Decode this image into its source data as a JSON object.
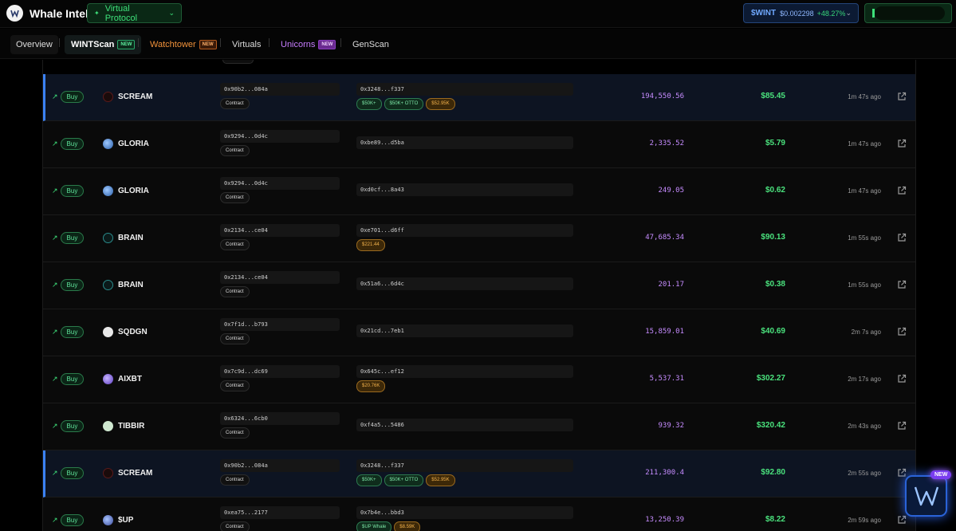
{
  "header": {
    "app_title": "Whale Intel",
    "protocol_selector": "Virtual Protocol",
    "token": {
      "symbol": "$WINT",
      "price": "$0.002298",
      "change": "+48.27%"
    }
  },
  "nav": {
    "tabs": [
      {
        "label": "Overview"
      },
      {
        "label": "WINTScan",
        "badge": "NEW"
      },
      {
        "label": "Watchtower",
        "badge": "NEW"
      },
      {
        "label": "Virtuals"
      },
      {
        "label": "Unicorns",
        "badge": "NEW"
      },
      {
        "label": "GenScan"
      }
    ]
  },
  "table": {
    "rows": [
      {
        "direction": "Buy",
        "token": "SCREAM",
        "token_address": "0x90b2...084a",
        "contract_label": "Contract",
        "tx": "0x3248...f337",
        "tags": [
          "$50K+",
          "$50K+ OTTO",
          "$52.95K"
        ],
        "amount": "194,550.56",
        "usd": "$85.45",
        "time": "1m 47s ago",
        "highlighted": true
      },
      {
        "direction": "Buy",
        "token": "GLORIA",
        "token_address": "0x9294...0d4c",
        "contract_label": "Contract",
        "tx": "0xbe89...d5ba",
        "tags": [],
        "amount": "2,335.52",
        "usd": "$5.79",
        "time": "1m 47s ago",
        "highlighted": false
      },
      {
        "direction": "Buy",
        "token": "GLORIA",
        "token_address": "0x9294...0d4c",
        "contract_label": "Contract",
        "tx": "0xd0cf...8a43",
        "tags": [],
        "amount": "249.05",
        "usd": "$0.62",
        "time": "1m 47s ago",
        "highlighted": false
      },
      {
        "direction": "Buy",
        "token": "BRAIN",
        "token_address": "0x2134...ce04",
        "contract_label": "Contract",
        "tx": "0xe701...d6ff",
        "tags": [
          "$221.44"
        ],
        "amount": "47,685.34",
        "usd": "$90.13",
        "time": "1m 55s ago",
        "highlighted": false
      },
      {
        "direction": "Buy",
        "token": "BRAIN",
        "token_address": "0x2134...ce04",
        "contract_label": "Contract",
        "tx": "0x51a6...6d4c",
        "tags": [],
        "amount": "201.17",
        "usd": "$0.38",
        "time": "1m 55s ago",
        "highlighted": false
      },
      {
        "direction": "Buy",
        "token": "SQDGN",
        "token_address": "0x7f1d...b793",
        "contract_label": "Contract",
        "tx": "0x21cd...7eb1",
        "tags": [],
        "amount": "15,859.01",
        "usd": "$40.69",
        "time": "2m 7s ago",
        "highlighted": false
      },
      {
        "direction": "Buy",
        "token": "AIXBT",
        "token_address": "0x7c9d...dc69",
        "contract_label": "Contract",
        "tx": "0x645c...ef12",
        "tags": [
          "$20.76K"
        ],
        "amount": "5,537.31",
        "usd": "$302.27",
        "time": "2m 17s ago",
        "highlighted": false
      },
      {
        "direction": "Buy",
        "token": "TIBBIR",
        "token_address": "0x6324...6cb0",
        "contract_label": "Contract",
        "tx": "0xf4a5...5486",
        "tags": [],
        "amount": "939.32",
        "usd": "$320.42",
        "time": "2m 43s ago",
        "highlighted": false
      },
      {
        "direction": "Buy",
        "token": "SCREAM",
        "token_address": "0x90b2...084a",
        "contract_label": "Contract",
        "tx": "0x3248...f337",
        "tags": [
          "$50K+",
          "$50K+ OTTO",
          "$52.95K"
        ],
        "amount": "211,300.4",
        "usd": "$92.80",
        "time": "2m 55s ago",
        "highlighted": true
      },
      {
        "direction": "Buy",
        "token": "$UP",
        "token_address": "0xea75...2177",
        "contract_label": "Contract",
        "tx": "0x7b4e...bbd3",
        "tags": [
          "$UP Whale",
          "$8.59K"
        ],
        "amount": "13,250.39",
        "usd": "$8.22",
        "time": "2m 59s ago",
        "highlighted": false
      }
    ]
  },
  "floating": {
    "badge": "NEW"
  },
  "colors": {
    "accent_green": "#4ae27d",
    "amount_purple": "#c68cff",
    "highlight_blue": "#3b82f6"
  }
}
